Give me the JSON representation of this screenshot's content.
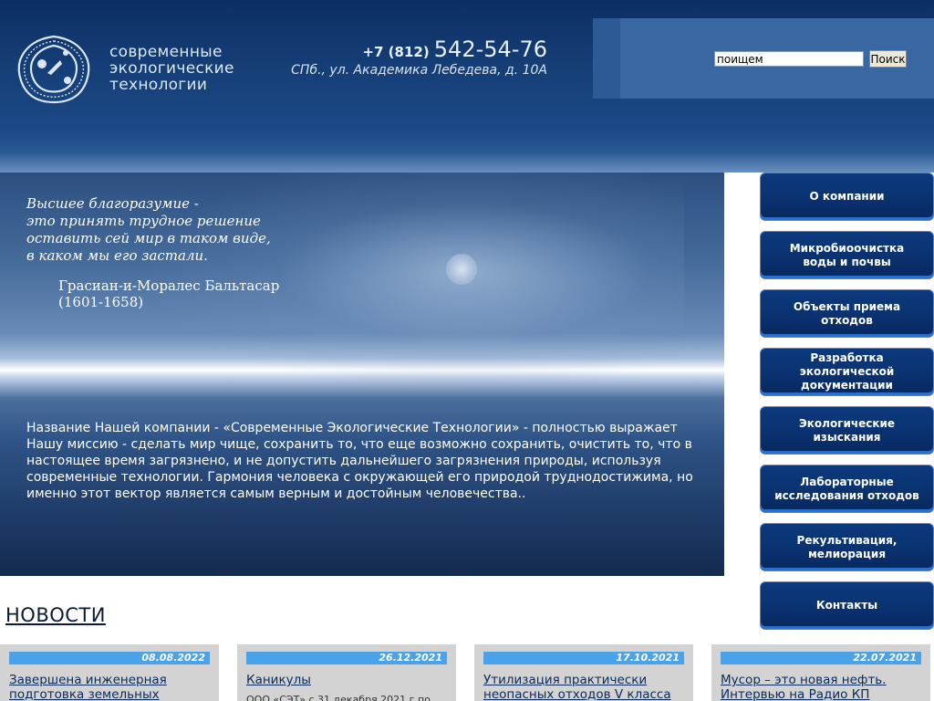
{
  "header": {
    "brand_lines": [
      "современные",
      "экологические",
      "технологии"
    ],
    "phone_prefix": "+7 (812)",
    "phone_number": "542-54-76",
    "address": "СПб., ул. Академика Лебедева, д. 10А",
    "logo_icon": "eco-logo-icon"
  },
  "search": {
    "value": "поищем",
    "button_label": "Поиск"
  },
  "hero": {
    "quote_lines": [
      "Высшее благоразумие -",
      "это принять трудное решение",
      "оставить сей мир в таком виде,",
      "в каком мы его застали."
    ],
    "author_lines": [
      "Грасиан-и-Моралес Бальтасар",
      "(1601-1658)"
    ],
    "mission": "Название Нашей компании - «Современные Экологические Технологии» - полностью выражает Нашу миссию - сделать мир чище, сохранить то, что еще возможно сохранить, очистить то, что в настоящее время загрязнено, и не допустить дальнейшего загрязнения природы, используя современные технологии. Гармония человека с окружающей его природой труднодостижима, но именно этот вектор является самым верным и достойным человечества.."
  },
  "nav": {
    "items": [
      {
        "label": "О компании"
      },
      {
        "label": "Микробиоочистка\nводы и почвы"
      },
      {
        "label": "Объекты приема\nотходов"
      },
      {
        "label": "Разработка экологической\nдокументации"
      },
      {
        "label": "Экологические\nизыскания"
      },
      {
        "label": "Лабораторные\nисследования отходов"
      },
      {
        "label": "Рекультивация,\nмелиорация"
      },
      {
        "label": "Контакты"
      }
    ]
  },
  "news": {
    "title": "НОВОСТИ",
    "items": [
      {
        "date": "08.08.2022",
        "headline": "Завершена инженерная подготовка земельных",
        "text": ""
      },
      {
        "date": "26.12.2021",
        "headline": "Каникулы",
        "text": "ООО «СЭТ» с 31 декабря 2021 г по"
      },
      {
        "date": "17.10.2021",
        "headline": "Утилизация практически неопасных отходов V класса",
        "text": ""
      },
      {
        "date": "22.07.2021",
        "headline": "Мусор – это новая нефть. Интервью на Радио КП",
        "text": ""
      }
    ]
  },
  "colors": {
    "header_bg": "#0c2f64",
    "nav_bg": "#0a3270",
    "news_date_bg": "#4aa3e8",
    "news_card_bg": "#d3d3d3"
  }
}
